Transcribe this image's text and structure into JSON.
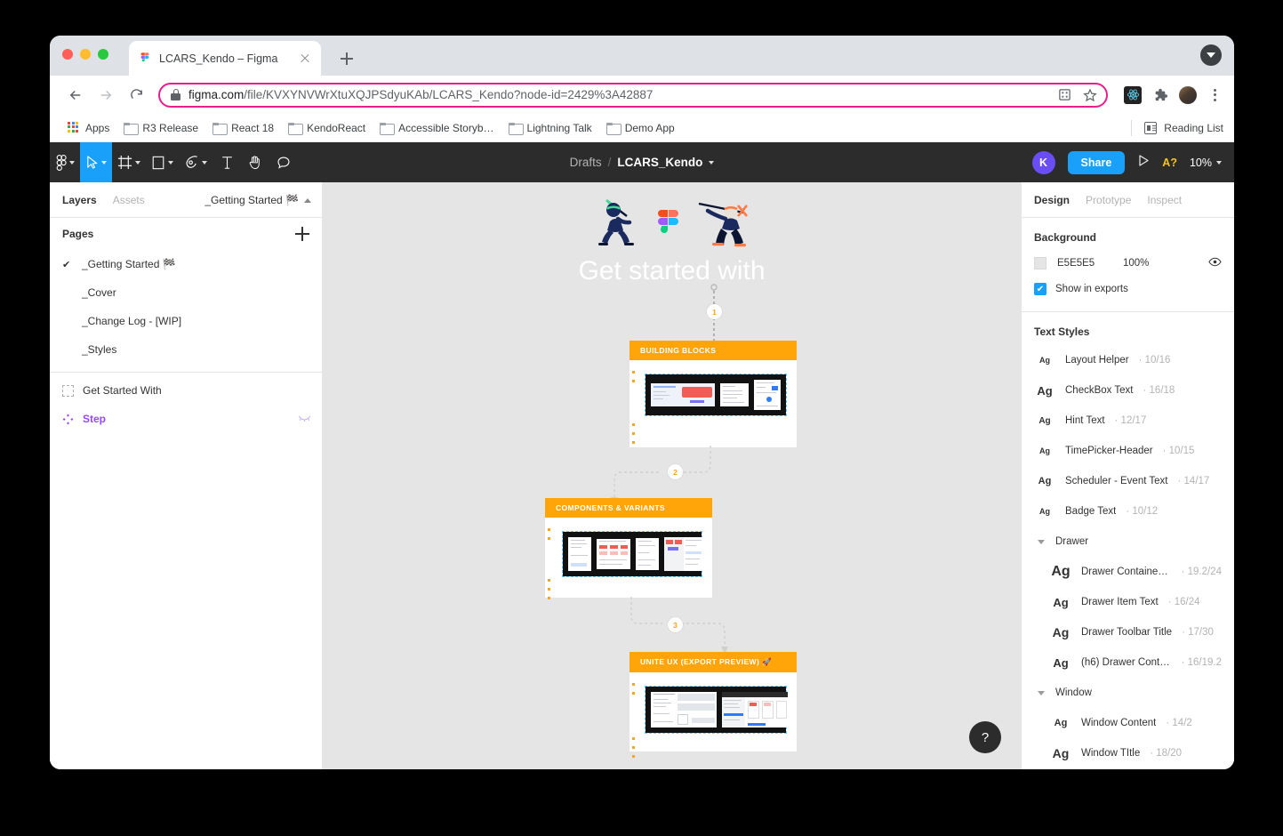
{
  "browser": {
    "tab": {
      "title": "LCARS_Kendo – Figma",
      "favicon": "figma-icon",
      "close": "close-icon"
    },
    "new_tab": "new-tab-icon",
    "window_controls": [
      "close",
      "minimize",
      "maximize"
    ],
    "nav": {
      "back": "back-arrow-icon",
      "forward": "forward-arrow-icon",
      "reload": "reload-icon"
    },
    "omnibox": {
      "lock": "lock-icon",
      "url_domain": "figma.com",
      "url_path": "/file/KVXYNVWrXtuXQJPSdyuKAb/LCARS_Kendo?node-id=2429%3A42887",
      "qr_icon": "qr-code-icon",
      "bookmark_icon": "star-icon",
      "highlight_color": "#e91e8c"
    },
    "extensions": [
      "react-devtools-icon",
      "puzzle-extensions-icon",
      "profile-avatar",
      "three-dot-menu-icon"
    ],
    "bookmarks": [
      {
        "label": "Apps",
        "icon": "apps-grid-icon"
      },
      {
        "label": "R3 Release",
        "icon": "folder-icon"
      },
      {
        "label": "React 18",
        "icon": "folder-icon"
      },
      {
        "label": "KendoReact",
        "icon": "folder-icon"
      },
      {
        "label": "Accessible Storyb…",
        "icon": "folder-icon"
      },
      {
        "label": "Lightning Talk",
        "icon": "folder-icon"
      },
      {
        "label": "Demo App",
        "icon": "folder-icon"
      }
    ],
    "reading_list": {
      "label": "Reading List",
      "icon": "reading-list-icon"
    },
    "tabstrip_menu": "tab-search-icon"
  },
  "figma": {
    "toolbar": {
      "tools": [
        {
          "name": "main-menu",
          "icon": "figma-logo-icon",
          "caret": true,
          "active": false
        },
        {
          "name": "move-tool",
          "icon": "cursor-icon",
          "caret": true,
          "active": true
        },
        {
          "name": "frame-tool",
          "icon": "frame-icon",
          "caret": true,
          "active": false
        },
        {
          "name": "shape-tool",
          "icon": "rectangle-icon",
          "caret": true,
          "active": false
        },
        {
          "name": "pen-tool",
          "icon": "pen-icon",
          "caret": true,
          "active": false
        },
        {
          "name": "text-tool",
          "icon": "text-t-icon",
          "caret": false,
          "active": false
        },
        {
          "name": "hand-tool",
          "icon": "hand-icon",
          "caret": false,
          "active": false
        },
        {
          "name": "comment-tool",
          "icon": "comment-bubble-icon",
          "caret": false,
          "active": false
        }
      ],
      "breadcrumb": {
        "project": "Drafts",
        "separator": "/",
        "file": "LCARS_Kendo",
        "caret": "chevron-down-icon"
      },
      "avatar_initial": "K",
      "share_label": "Share",
      "present_icon": "present-play-icon",
      "a_badge": "A?",
      "zoom_level": "10%",
      "accent_blue": "#18a0fb"
    },
    "left_panel": {
      "tabs": [
        {
          "label": "Layers",
          "active": true
        },
        {
          "label": "Assets",
          "active": false
        }
      ],
      "page_selector": "_Getting Started 🏁",
      "pages_label": "Pages",
      "add_page_icon": "plus-icon",
      "pages": [
        {
          "label": "_Getting Started 🏁",
          "selected": true
        },
        {
          "label": "_Cover",
          "selected": false
        },
        {
          "label": "_Change Log - [WIP]",
          "selected": false
        },
        {
          "label": "_Styles",
          "selected": false
        }
      ],
      "layers": [
        {
          "label": "Get Started With",
          "icon": "frame-icon",
          "type": "frame"
        },
        {
          "label": "Step",
          "icon": "component-diamond-icon",
          "type": "component",
          "visibility_icon": "eye-closed-icon"
        }
      ]
    },
    "canvas": {
      "background_color": "#e5e5e5",
      "hero_title": "Get started with",
      "hero_graphics": [
        "ninja-left",
        "figma-logo",
        "ninja-right"
      ],
      "connectors": [
        {
          "number": "1"
        },
        {
          "number": "2"
        },
        {
          "number": "3"
        }
      ],
      "cards": [
        {
          "title": "BUILDING BLOCKS",
          "thumbs": 3
        },
        {
          "title": "COMPONENTS & VARIANTS",
          "thumbs": 4
        },
        {
          "title": "UNITE UX (EXPORT PREVIEW) 🚀",
          "thumbs": 2
        }
      ],
      "header_color": "#ffa50a",
      "help_button": "?"
    },
    "right_panel": {
      "tabs": [
        {
          "label": "Design",
          "active": true
        },
        {
          "label": "Prototype",
          "active": false
        },
        {
          "label": "Inspect",
          "active": false
        }
      ],
      "background": {
        "title": "Background",
        "hex": "E5E5E5",
        "opacity": "100%",
        "visibility_icon": "eye-icon",
        "show_in_exports": "Show in exports",
        "show_in_exports_checked": true
      },
      "text_styles": {
        "title": "Text Styles",
        "items": [
          {
            "name": "Layout Helper",
            "meta": "· 10/16",
            "indent": 0,
            "group": false,
            "ag": "Ag",
            "ag_size": 9
          },
          {
            "name": "CheckBox Text",
            "meta": "· 16/18",
            "indent": 0,
            "group": false,
            "ag": "Ag",
            "ag_size": 13
          },
          {
            "name": "Hint Text",
            "meta": "· 12/17",
            "indent": 0,
            "group": false,
            "ag": "Ag",
            "ag_size": 10
          },
          {
            "name": "TimePicker-Header",
            "meta": "· 10/15",
            "indent": 0,
            "group": false,
            "ag": "Ag",
            "ag_size": 9
          },
          {
            "name": "Scheduler - Event Text",
            "meta": "· 14/17",
            "indent": 0,
            "group": false,
            "ag": "Ag",
            "ag_size": 11
          },
          {
            "name": "Badge Text",
            "meta": "· 10/12",
            "indent": 0,
            "group": false,
            "ag": "Ag",
            "ag_size": 9
          },
          {
            "name": "Drawer",
            "meta": "",
            "indent": 0,
            "group": true,
            "ag": "",
            "ag_size": 0
          },
          {
            "name": "Drawer Container Text",
            "meta": "· 19.2/24",
            "indent": 1,
            "group": false,
            "ag": "Ag",
            "ag_size": 16
          },
          {
            "name": "Drawer Item Text",
            "meta": "· 16/24",
            "indent": 1,
            "group": false,
            "ag": "Ag",
            "ag_size": 13
          },
          {
            "name": "Drawer Toolbar Title",
            "meta": "· 17/30",
            "indent": 1,
            "group": false,
            "ag": "Ag",
            "ag_size": 14
          },
          {
            "name": "(h6) Drawer Contain…",
            "meta": "· 16/19.2",
            "indent": 1,
            "group": false,
            "ag": "Ag",
            "ag_size": 13
          },
          {
            "name": "Window",
            "meta": "",
            "indent": 0,
            "group": true,
            "ag": "",
            "ag_size": 0
          },
          {
            "name": "Window Content",
            "meta": "· 14/2",
            "indent": 1,
            "group": false,
            "ag": "Ag",
            "ag_size": 11
          },
          {
            "name": "Window TItle",
            "meta": "· 18/20",
            "indent": 1,
            "group": false,
            "ag": "Ag",
            "ag_size": 14
          }
        ]
      }
    }
  }
}
